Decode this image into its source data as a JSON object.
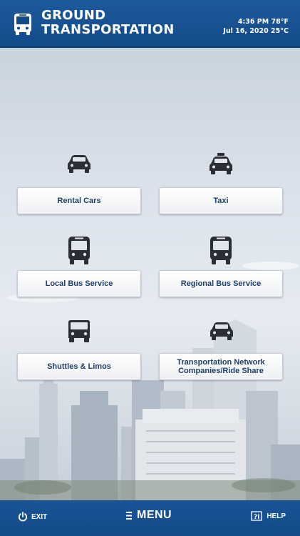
{
  "header": {
    "title": "GROUND TRANSPORTATION",
    "time_temp_f": "4:36 PM  78°F",
    "date_temp_c": "Jul 16, 2020  25°C",
    "icon": "bus-icon"
  },
  "options": [
    {
      "label": "Rental Cars",
      "icon": "car-icon"
    },
    {
      "label": "Taxi",
      "icon": "taxi-icon"
    },
    {
      "label": "Local Bus Service",
      "icon": "bus-icon"
    },
    {
      "label": "Regional Bus Service",
      "icon": "bus-icon"
    },
    {
      "label": "Shuttles & Limos",
      "icon": "shuttle-icon"
    },
    {
      "label": "Transportation Network Companies/Ride Share",
      "icon": "car-icon"
    }
  ],
  "footer": {
    "exit_label": "EXIT",
    "menu_label": "MENU",
    "help_label": "HELP"
  },
  "colors": {
    "header_bg": "#134a88",
    "tile_text": "#1f3f66",
    "icon": "#2b2e33"
  }
}
